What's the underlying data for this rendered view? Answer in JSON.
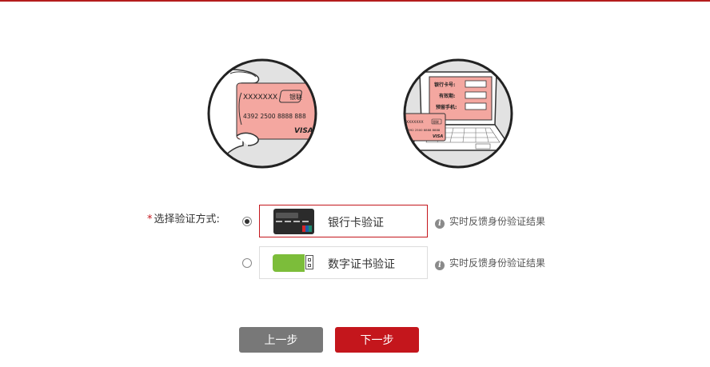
{
  "verify": {
    "required_mark": "*",
    "label": "选择验证方式:",
    "options": [
      {
        "label": "银行卡验证",
        "selected": true,
        "icon": "bank-card-icon",
        "info": "实时反馈身份验证结果"
      },
      {
        "label": "数字证书验证",
        "selected": false,
        "icon": "usb-key-icon",
        "info": "实时反馈身份验证结果"
      }
    ]
  },
  "illustration_card": {
    "name_text": "XXXXXXX",
    "brand_text": "银联",
    "number_text": "4392 2500 8888 888",
    "network_text": "VISA"
  },
  "illustration_form": {
    "field1": "银行卡号:",
    "field2": "有效期:",
    "field3": "预留手机:",
    "card_name": "XXXXXXX",
    "card_brand": "银联",
    "card_number": "4392 2500 8888 8888",
    "card_network": "VISA"
  },
  "buttons": {
    "prev": "上一步",
    "next": "下一步"
  },
  "colors": {
    "accent": "#c4161c",
    "card_pink": "#f4a7a0",
    "cert_green": "#7cbd3a",
    "prev_gray": "#787878"
  }
}
